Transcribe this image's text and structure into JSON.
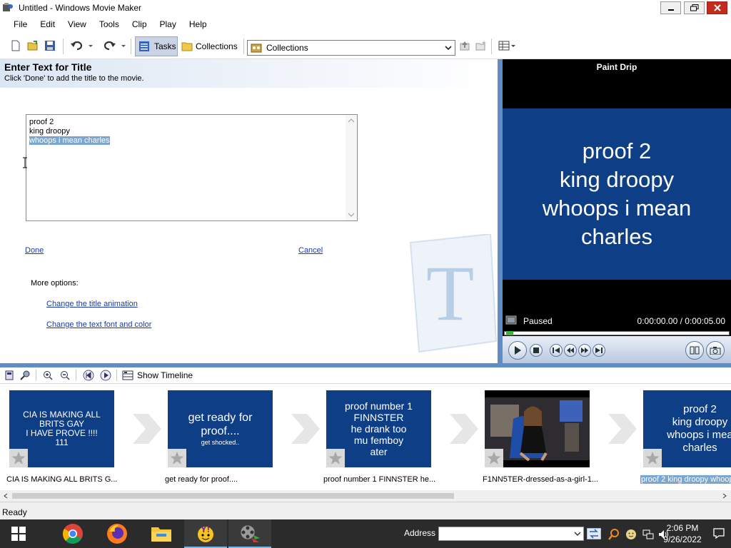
{
  "window": {
    "title": "Untitled - Windows Movie Maker"
  },
  "menu": [
    "File",
    "Edit",
    "View",
    "Tools",
    "Clip",
    "Play",
    "Help"
  ],
  "toolbar": {
    "tasks_label": "Tasks",
    "collections_label": "Collections",
    "collections_select": "Collections"
  },
  "taskpane": {
    "heading": "Enter Text for Title",
    "subtitle": "Click 'Done' to add the title to the movie.",
    "textarea_lines": [
      "proof 2",
      "king droopy",
      "whoops i mean charles"
    ],
    "done_label": "Done",
    "cancel_label": "Cancel",
    "more_options_label": "More options:",
    "change_animation_label": "Change the title animation",
    "change_font_label": "Change the text font and color"
  },
  "preview": {
    "title": "Paint Drip",
    "screen_lines": [
      "proof 2",
      "king droopy",
      "whoops i mean",
      "charles"
    ],
    "state": "Paused",
    "time": "0:00:00.00 / 0:00:05.00",
    "progress_fraction": 0
  },
  "storyboard": {
    "show_timeline_label": "Show Timeline",
    "clips": [
      {
        "lines": [
          "CIA IS MAKING ALL",
          "BRITS GAY",
          "I HAVE PROVE !!!!",
          "111"
        ],
        "label": "CIA IS MAKING ALL BRITS G...",
        "type": "title"
      },
      {
        "lines": [
          "get ready for",
          "proof....",
          "get shocked.."
        ],
        "label": "get ready for proof....",
        "type": "title"
      },
      {
        "lines": [
          "proof number 1",
          "FINNSTER",
          "he drank too",
          "mu femboy",
          "ater"
        ],
        "label": "proof number 1 FINNSTER he...",
        "type": "title"
      },
      {
        "lines": [],
        "label": "F1NN5TER-dressed-as-a-girl-1...",
        "type": "video"
      },
      {
        "lines": [
          "proof 2",
          "king droopy",
          "whoops i mea",
          "charles"
        ],
        "label": "proof 2 king droopy whoop",
        "type": "title",
        "selected": true
      }
    ]
  },
  "status": {
    "text": "Ready"
  },
  "taskbar": {
    "address_label": "Address",
    "time": "2:06 PM",
    "date": "9/26/2022"
  }
}
